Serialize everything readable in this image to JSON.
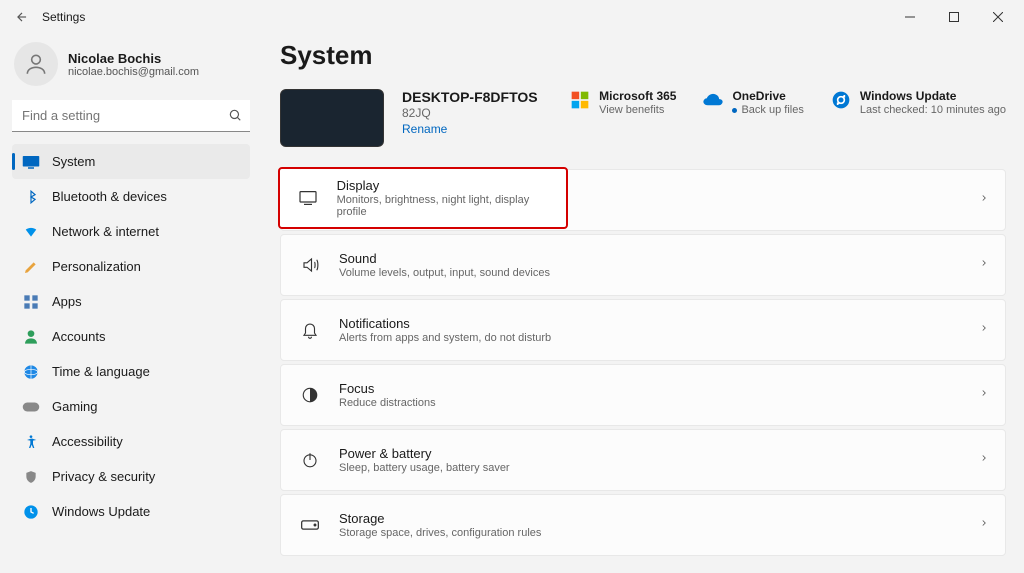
{
  "window": {
    "title": "Settings"
  },
  "user": {
    "name": "Nicolae Bochis",
    "email": "nicolae.bochis@gmail.com"
  },
  "search": {
    "placeholder": "Find a setting"
  },
  "nav": [
    {
      "label": "System"
    },
    {
      "label": "Bluetooth & devices"
    },
    {
      "label": "Network & internet"
    },
    {
      "label": "Personalization"
    },
    {
      "label": "Apps"
    },
    {
      "label": "Accounts"
    },
    {
      "label": "Time & language"
    },
    {
      "label": "Gaming"
    },
    {
      "label": "Accessibility"
    },
    {
      "label": "Privacy & security"
    },
    {
      "label": "Windows Update"
    }
  ],
  "page": {
    "title": "System"
  },
  "device": {
    "name": "DESKTOP-F8DFTOS",
    "model": "82JQ",
    "rename": "Rename"
  },
  "status": {
    "m365": {
      "title": "Microsoft 365",
      "sub": "View benefits"
    },
    "onedrive": {
      "title": "OneDrive",
      "sub": "Back up files"
    },
    "update": {
      "title": "Windows Update",
      "sub": "Last checked: 10 minutes ago"
    }
  },
  "settings": [
    {
      "title": "Display",
      "sub": "Monitors, brightness, night light, display profile"
    },
    {
      "title": "Sound",
      "sub": "Volume levels, output, input, sound devices"
    },
    {
      "title": "Notifications",
      "sub": "Alerts from apps and system, do not disturb"
    },
    {
      "title": "Focus",
      "sub": "Reduce distractions"
    },
    {
      "title": "Power & battery",
      "sub": "Sleep, battery usage, battery saver"
    },
    {
      "title": "Storage",
      "sub": "Storage space, drives, configuration rules"
    }
  ]
}
